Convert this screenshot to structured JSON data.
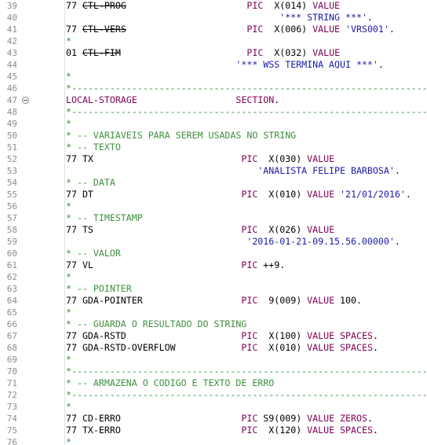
{
  "editor": {
    "lines": [
      {
        "n": "39",
        "segs": [
          [
            "",
            "77 "
          ],
          [
            "struck",
            "CTL-PROG"
          ],
          [
            "",
            "                      "
          ],
          [
            "kw",
            "PIC"
          ],
          [
            "",
            "  X(014) "
          ],
          [
            "kw",
            "VALUE"
          ]
        ]
      },
      {
        "n": "40",
        "segs": [
          [
            "",
            "                                       "
          ],
          [
            "str",
            "'*** STRING ***'"
          ],
          [
            "",
            "."
          ]
        ]
      },
      {
        "n": "41",
        "segs": [
          [
            "",
            "77 "
          ],
          [
            "struck",
            "CTL-VERS"
          ],
          [
            "",
            "                      "
          ],
          [
            "kw",
            "PIC"
          ],
          [
            "",
            "  X(006) "
          ],
          [
            "kw",
            "VALUE"
          ],
          [
            "",
            " "
          ],
          [
            "str",
            "'VRS001'"
          ],
          [
            "",
            "."
          ]
        ]
      },
      {
        "n": "42",
        "segs": [
          [
            "cmt",
            "*"
          ]
        ]
      },
      {
        "n": "43",
        "segs": [
          [
            "",
            "01 "
          ],
          [
            "struck",
            "CTL-FIM"
          ],
          [
            "",
            "                       "
          ],
          [
            "kw",
            "PIC"
          ],
          [
            "",
            "  X(032) "
          ],
          [
            "kw",
            "VALUE"
          ]
        ]
      },
      {
        "n": "44",
        "segs": [
          [
            "",
            "                               "
          ],
          [
            "str",
            "'*** WSS TERMINA AQUI ***'"
          ],
          [
            "",
            "."
          ]
        ]
      },
      {
        "n": "45",
        "segs": [
          [
            "cmt",
            "*"
          ]
        ]
      },
      {
        "n": "46",
        "segs": [
          [
            "cmt",
            "*-----------------------------------------------------------------"
          ]
        ]
      },
      {
        "n": "47",
        "fold": true,
        "segs": [
          [
            "kw",
            "LOCAL-STORAGE"
          ],
          [
            "",
            "                  "
          ],
          [
            "kw",
            "SECTION"
          ],
          [
            "",
            "."
          ]
        ]
      },
      {
        "n": "48",
        "segs": [
          [
            "cmt",
            "*-----------------------------------------------------------------"
          ]
        ]
      },
      {
        "n": "49",
        "segs": [
          [
            "cmt",
            "*"
          ]
        ]
      },
      {
        "n": "50",
        "segs": [
          [
            "cmt",
            "* -- VARIAVEIS PARA SEREM USADAS NO STRING"
          ]
        ]
      },
      {
        "n": "51",
        "segs": [
          [
            "cmt",
            "* -- TEXTO"
          ]
        ]
      },
      {
        "n": "52",
        "segs": [
          [
            "",
            "77 TX                           "
          ],
          [
            "kw",
            "PIC"
          ],
          [
            "",
            "  X(030) "
          ],
          [
            "kw",
            "VALUE"
          ]
        ]
      },
      {
        "n": "53",
        "segs": [
          [
            "",
            "                                   "
          ],
          [
            "str",
            "'ANALISTA FELIPE BARBOSA'"
          ],
          [
            "",
            "."
          ]
        ]
      },
      {
        "n": "54",
        "segs": [
          [
            "cmt",
            "* -- DATA"
          ]
        ]
      },
      {
        "n": "55",
        "segs": [
          [
            "",
            "77 DT                           "
          ],
          [
            "kw",
            "PIC"
          ],
          [
            "",
            "  X(010) "
          ],
          [
            "kw",
            "VALUE"
          ],
          [
            "",
            " "
          ],
          [
            "str",
            "'21/01/2016'"
          ],
          [
            "",
            "."
          ]
        ]
      },
      {
        "n": "56",
        "segs": [
          [
            "cmt",
            "*"
          ]
        ]
      },
      {
        "n": "57",
        "segs": [
          [
            "cmt",
            "* -- TIMESTAMP"
          ]
        ]
      },
      {
        "n": "58",
        "segs": [
          [
            "",
            "77 TS                           "
          ],
          [
            "kw",
            "PIC"
          ],
          [
            "",
            "  X(026) "
          ],
          [
            "kw",
            "VALUE"
          ]
        ]
      },
      {
        "n": "59",
        "segs": [
          [
            "",
            "                                 "
          ],
          [
            "str",
            "'2016-01-21-09.15.56.00000'"
          ],
          [
            "",
            "."
          ]
        ]
      },
      {
        "n": "60",
        "segs": [
          [
            "cmt",
            "* -- VALOR"
          ]
        ]
      },
      {
        "n": "61",
        "segs": [
          [
            "",
            "77 VL                           "
          ],
          [
            "kw",
            "PIC"
          ],
          [
            "",
            " ++9."
          ]
        ]
      },
      {
        "n": "62",
        "segs": [
          [
            "cmt",
            "*"
          ]
        ]
      },
      {
        "n": "63",
        "segs": [
          [
            "cmt",
            "* -- POINTER"
          ]
        ]
      },
      {
        "n": "64",
        "segs": [
          [
            "",
            "77 GDA-POINTER                  "
          ],
          [
            "kw",
            "PIC"
          ],
          [
            "",
            "  9(009) "
          ],
          [
            "kw",
            "VALUE"
          ],
          [
            "",
            " 100."
          ]
        ]
      },
      {
        "n": "65",
        "segs": [
          [
            "cmt",
            "*"
          ]
        ]
      },
      {
        "n": "66",
        "segs": [
          [
            "cmt",
            "* -- GUARDA O RESULTADO DO STRING"
          ]
        ]
      },
      {
        "n": "67",
        "segs": [
          [
            "",
            "77 GDA-RSTD                     "
          ],
          [
            "kw",
            "PIC"
          ],
          [
            "",
            "  X(100) "
          ],
          [
            "kw",
            "VALUE"
          ],
          [
            "",
            " "
          ],
          [
            "kw",
            "SPACES"
          ],
          [
            "",
            "."
          ]
        ]
      },
      {
        "n": "68",
        "segs": [
          [
            "",
            "77 GDA-RSTD-OVERFLOW            "
          ],
          [
            "kw",
            "PIC"
          ],
          [
            "",
            "  X(010) "
          ],
          [
            "kw",
            "VALUE"
          ],
          [
            "",
            " "
          ],
          [
            "kw",
            "SPACES"
          ],
          [
            "",
            "."
          ]
        ]
      },
      {
        "n": "69",
        "segs": [
          [
            "cmt",
            "*"
          ]
        ]
      },
      {
        "n": "70",
        "segs": [
          [
            "cmt",
            "*-----------------------------------------------------------------"
          ]
        ]
      },
      {
        "n": "71",
        "segs": [
          [
            "cmt",
            "* -- ARMAZENA O CODIGO E TEXTO DE ERRO"
          ]
        ]
      },
      {
        "n": "72",
        "segs": [
          [
            "cmt",
            "*-----------------------------------------------------------------"
          ]
        ]
      },
      {
        "n": "73",
        "segs": [
          [
            "cmt",
            "*"
          ]
        ]
      },
      {
        "n": "74",
        "segs": [
          [
            "",
            "77 CD-ERRO                      "
          ],
          [
            "kw",
            "PIC"
          ],
          [
            "",
            " S9(009) "
          ],
          [
            "kw",
            "VALUE"
          ],
          [
            "",
            " "
          ],
          [
            "kw",
            "ZEROS"
          ],
          [
            "",
            "."
          ]
        ]
      },
      {
        "n": "75",
        "segs": [
          [
            "",
            "77 TX-ERRO                      "
          ],
          [
            "kw",
            "PIC"
          ],
          [
            "",
            "  X(120) "
          ],
          [
            "kw",
            "VALUE"
          ],
          [
            "",
            " "
          ],
          [
            "kw",
            "SPACES"
          ],
          [
            "",
            "."
          ]
        ]
      },
      {
        "n": "76",
        "segs": [
          [
            "cmt",
            "*"
          ]
        ]
      }
    ]
  },
  "colors": {
    "comment": "#3f8f3f",
    "keyword": "#7f0055",
    "string": "#1a1aa6",
    "line_number": "#8c8c8c"
  },
  "icons": {
    "fold": "fold-collapse-icon"
  }
}
